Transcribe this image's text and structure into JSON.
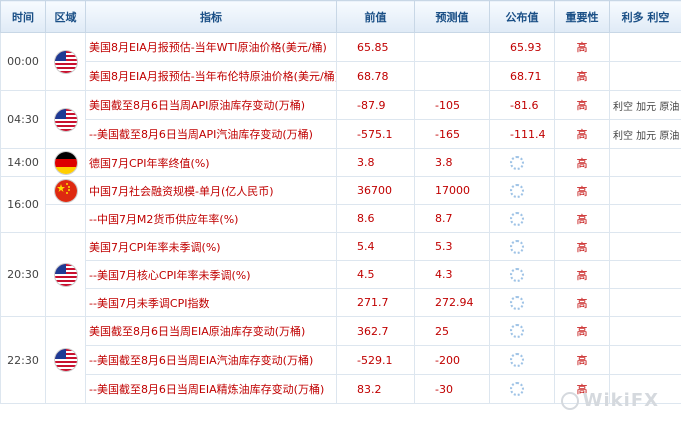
{
  "header": {
    "time": "时间",
    "region": "区域",
    "indicator": "指标",
    "previous": "前值",
    "forecast": "预测值",
    "actual": "公布值",
    "importance": "重要性",
    "effect": "利多 利空"
  },
  "rows": [
    {
      "time": "00:00",
      "flag": "us",
      "indicator": "美国8月EIA月报预估-当年WTI原油价格(美元/桶)",
      "previous": "65.85",
      "forecast": "",
      "actual": "65.93",
      "importance": "高",
      "effect": ""
    },
    {
      "time": "",
      "flag": "",
      "indicator": "美国8月EIA月报预估-当年布伦特原油价格(美元/桶)",
      "previous": "68.78",
      "forecast": "",
      "actual": "68.71",
      "importance": "高",
      "effect": ""
    },
    {
      "time": "04:30",
      "flag": "us",
      "indicator": "美国截至8月6日当周API原油库存变动(万桶)",
      "previous": "-87.9",
      "forecast": "-105",
      "actual": "-81.6",
      "importance": "高",
      "effect": "利空 加元 原油"
    },
    {
      "time": "",
      "flag": "",
      "indicator": "--美国截至8月6日当周API汽油库存变动(万桶)",
      "previous": "-575.1",
      "forecast": "-165",
      "actual": "-111.4",
      "importance": "高",
      "effect": "利空 加元 原油"
    },
    {
      "time": "14:00",
      "flag": "de",
      "indicator": "德国7月CPI年率终值(%)",
      "previous": "3.8",
      "forecast": "3.8",
      "actual": "",
      "importance": "高",
      "effect": ""
    },
    {
      "time": "16:00",
      "flag": "cn",
      "indicator": "中国7月社会融资规模-单月(亿人民币)",
      "previous": "36700",
      "forecast": "17000",
      "actual": "",
      "importance": "高",
      "effect": ""
    },
    {
      "time": "",
      "flag": "",
      "indicator": "--中国7月M2货币供应年率(%)",
      "previous": "8.6",
      "forecast": "8.7",
      "actual": "",
      "importance": "高",
      "effect": ""
    },
    {
      "time": "20:30",
      "flag": "us",
      "indicator": "美国7月CPI年率未季调(%)",
      "previous": "5.4",
      "forecast": "5.3",
      "actual": "",
      "importance": "高",
      "effect": ""
    },
    {
      "time": "",
      "flag": "",
      "indicator": "--美国7月核心CPI年率未季调(%)",
      "previous": "4.5",
      "forecast": "4.3",
      "actual": "",
      "importance": "高",
      "effect": ""
    },
    {
      "time": "",
      "flag": "",
      "indicator": "--美国7月未季调CPI指数",
      "previous": "271.7",
      "forecast": "272.94",
      "actual": "",
      "importance": "高",
      "effect": ""
    },
    {
      "time": "22:30",
      "flag": "us",
      "indicator": "美国截至8月6日当周EIA原油库存变动(万桶)",
      "previous": "362.7",
      "forecast": "25",
      "actual": "",
      "importance": "高",
      "effect": ""
    },
    {
      "time": "",
      "flag": "",
      "indicator": "--美国截至8月6日当周EIA汽油库存变动(万桶)",
      "previous": "-529.1",
      "forecast": "-200",
      "actual": "",
      "importance": "高",
      "effect": ""
    },
    {
      "time": "",
      "flag": "",
      "indicator": "--美国截至8月6日当周EIA精炼油库存变动(万桶)",
      "previous": "83.2",
      "forecast": "-30",
      "actual": "",
      "importance": "高",
      "effect": ""
    }
  ],
  "watermark": "WikiFX",
  "colors": {
    "header_text": "#1a4f86",
    "value_red": "#c00000",
    "divider_red": "#dd3333"
  }
}
